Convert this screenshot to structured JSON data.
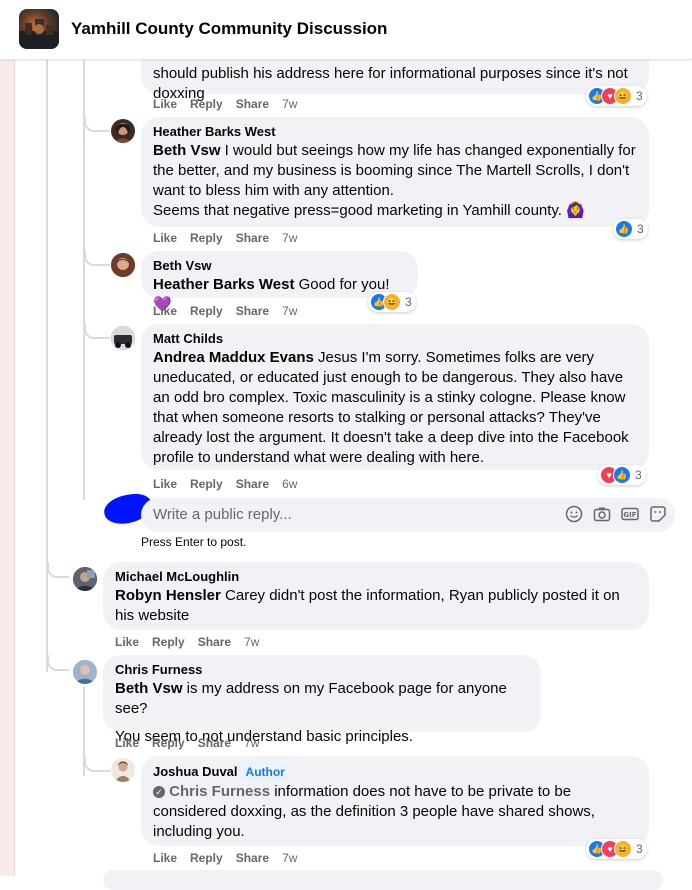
{
  "header": {
    "group_name": "Yamhill County Community Discussion"
  },
  "actions": {
    "like": "Like",
    "reply": "Reply",
    "share": "Share"
  },
  "comments": [
    {
      "text": "should publish his address here for informational purposes since it's not doxxing",
      "time": "7w",
      "reaction_count": "3"
    },
    {
      "author": "Heather Barks West",
      "mention": "Beth Vsw",
      "text": " I would but seeings how my life has changed exponentially for the better, and my business is booming since The Martell Scrolls, I don't want to bless him with any attention.",
      "text2": "Seems that negative press=good marketing in Yamhill county. 🙆‍♀️",
      "time": "7w",
      "reaction_count": "3"
    },
    {
      "author": "Beth Vsw",
      "mention": "Heather Barks West",
      "text": " Good for you! 💜",
      "time": "7w",
      "reaction_count": "3"
    },
    {
      "author": "Matt Childs",
      "mention": "Andrea Maddux Evans",
      "text": " Jesus I'm sorry. Sometimes folks are very uneducated, or educated just enough to be dangerous. They also have an odd bro complex. Toxic masculinity is a stinky cologne. Please know that when someone resorts to stalking or personal attacks? They've already lost the argument. It doesn't take a deep dive into the Facebook profile to understand what were dealing with here.",
      "time": "6w",
      "reaction_count": "3"
    },
    {
      "author": "Michael McLoughlin",
      "mention": "Robyn Hensler",
      "text": " Carey didn't post the information, Ryan publicly posted it on his website",
      "time": "7w"
    },
    {
      "author": "Chris Furness",
      "mention": "Beth Vsw",
      "text": " is my address on my Facebook page for anyone see?",
      "text2": "You seem to not understand basic principles.",
      "time": "7w"
    },
    {
      "author": "Joshua Duval",
      "badge": "Author",
      "mention": "Chris Furness",
      "text": " information does not have to be private to be considered doxxing, as the definition 3 people have shared shows, including you.",
      "time": "7w",
      "reaction_count": "3"
    }
  ],
  "reply_box": {
    "placeholder": "Write a public reply...",
    "hint": "Press Enter to post."
  },
  "colors": {
    "like": "#1877f2",
    "love": "#f33e58",
    "haha": "#f7b125",
    "bubble": "#f0f2f5",
    "link": "#1877f2"
  },
  "icons": [
    "emoji-icon",
    "camera-icon",
    "gif-icon",
    "sticker-icon",
    "like-reaction-icon",
    "love-reaction-icon",
    "haha-reaction-icon",
    "verified-check-icon"
  ]
}
